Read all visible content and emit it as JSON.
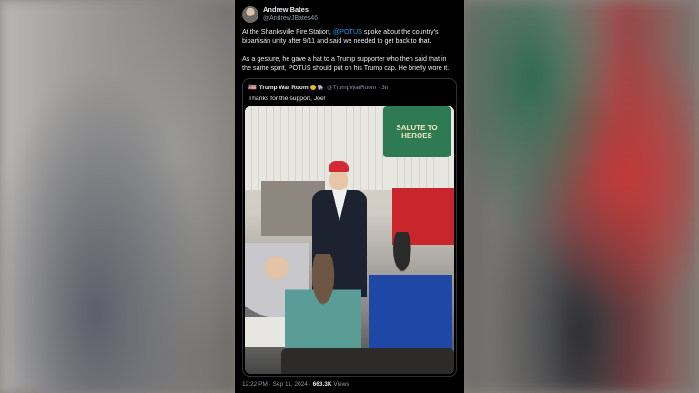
{
  "tweet": {
    "display_name": "Andrew Bates",
    "handle": "@AndrewJBates46",
    "paragraph1_pre": "At the Shanksville Fire Station, ",
    "paragraph1_mention": "@POTUS",
    "paragraph1_post": " spoke about the country's bipartisan unity after 9/11 and said we needed to get back to that.",
    "paragraph2": "As a gesture, he gave a hat to a Trump supporter who then said that in the  same spirit, POTUS should put on his Trump cap. He briefly wore it.",
    "time": "12:22 PM",
    "separator": "·",
    "date": "Sep 11, 2024",
    "views_count": "663.3K",
    "views_label": "Views"
  },
  "quoted": {
    "flag": "🇺🇸",
    "display_name": "Trump War Room",
    "emoji": "🐘",
    "handle": "@TrumpWarRoom",
    "age": "3h",
    "text": "Thanks for the support, Joe!"
  },
  "media": {
    "sign_text": "SALUTE TO HEROES"
  },
  "colors": {
    "mention": "#1d9bf0",
    "background": "#000000",
    "verified_badge": "#e8b829"
  },
  "icons": [
    "verified-badge-icon",
    "flag-icon",
    "elephant-icon",
    "avatar"
  ]
}
